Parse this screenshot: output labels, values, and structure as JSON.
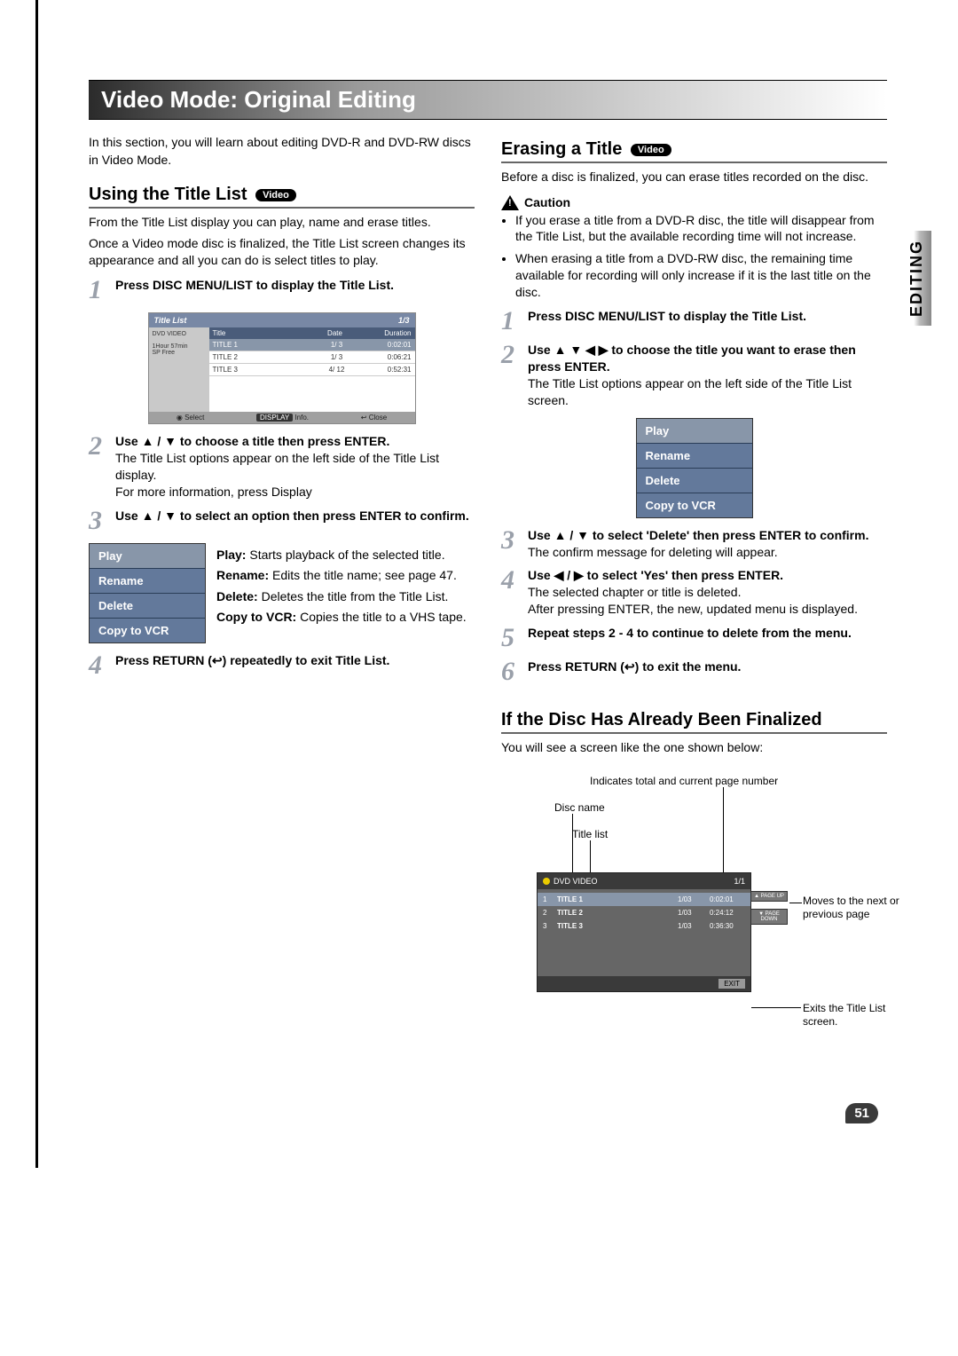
{
  "side_tab": "EDITING",
  "header": "Video Mode: Original Editing",
  "page_number": "51",
  "left": {
    "intro": "In this section, you will learn about editing DVD-R and DVD-RW discs in Video Mode.",
    "h2": "Using the Title List",
    "badge": "Video",
    "p1": "From the Title List display you can play, name and erase titles.",
    "p2": "Once a Video mode disc is finalized, the Title List screen changes its appearance and all you can do is select titles to play.",
    "step1": "Press DISC MENU/LIST to display the Title List.",
    "titlelist": {
      "header": "Title List",
      "page": "1/3",
      "cols": {
        "title": "Title",
        "date": "Date",
        "duration": "Duration"
      },
      "side": {
        "disc": "DVD VIDEO",
        "rec": "1Hour 57min",
        "mode": "SP Free"
      },
      "rows": [
        {
          "title": "TITLE 1",
          "date": "1/ 3",
          "dur": "0:02:01"
        },
        {
          "title": "TITLE 2",
          "date": "1/ 3",
          "dur": "0:06:21"
        },
        {
          "title": "TITLE 3",
          "date": "4/ 12",
          "dur": "0:52:31"
        }
      ],
      "foot": {
        "select": "Select",
        "display": "DISPLAY",
        "info": "Info.",
        "close": "Close"
      }
    },
    "step2": "Use ▲ / ▼ to choose a title then press ENTER.",
    "step2b": "The Title List options appear on the left side of the Title List display.",
    "step2c": "For more information, press Display",
    "step3": "Use ▲ / ▼ to select an option then press ENTER to confirm.",
    "options": [
      "Play",
      "Rename",
      "Delete",
      "Copy to VCR"
    ],
    "desc_play_label": "Play:",
    "desc_play": " Starts playback of the selected title.",
    "desc_rename_label": "Rename:",
    "desc_rename": " Edits the title name; see page 47.",
    "desc_delete_label": "Delete:",
    "desc_delete": " Deletes the title from the Title List.",
    "desc_copy_label": "Copy to VCR:",
    "desc_copy": " Copies the title to a VHS tape.",
    "step4": "Press RETURN (↩) repeatedly to exit Title List."
  },
  "right": {
    "h2": "Erasing a Title",
    "badge": "Video",
    "p1": "Before a disc is finalized, you can erase titles recorded on the disc.",
    "caution": "Caution",
    "c1": "If you erase a title from a DVD-R disc, the title will disappear from the Title List, but the available recording time will not increase.",
    "c2": "When erasing a title from a DVD-RW disc, the remaining time available for recording will only increase if it is the last title on the disc.",
    "step1": "Press DISC MENU/LIST to display the Title List.",
    "step2": "Use ▲ ▼ ◀ ▶ to choose the title you want to erase then press ENTER.",
    "step2b": "The Title List options appear on the left side of the Title List screen.",
    "options": [
      "Play",
      "Rename",
      "Delete",
      "Copy to VCR"
    ],
    "step3": "Use ▲ / ▼ to select 'Delete' then press ENTER to confirm.",
    "step3b": "The confirm message for deleting will appear.",
    "step4": "Use ◀ / ▶ to select 'Yes' then press ENTER.",
    "step4b": "The selected chapter or title is deleted.",
    "step4c": "After pressing ENTER, the new, updated menu is displayed.",
    "step5": "Repeat steps 2 - 4 to continue to delete from the menu.",
    "step6": "Press RETURN (↩) to exit the menu.",
    "h2b": "If the Disc Has Already Been Finalized",
    "p_final": "You will see a screen like the one shown below:",
    "callouts": {
      "total": "Indicates total and current page number",
      "disc_name": "Disc name",
      "title_list": "Title list",
      "move": "Moves to the next or previous page",
      "exit": "Exits the Title List screen."
    },
    "dvd": {
      "label": "DVD VIDEO",
      "page": "1/1",
      "rows": [
        {
          "n": "1",
          "title": "TITLE 1",
          "date": "1/03",
          "dur": "0:02:01"
        },
        {
          "n": "2",
          "title": "TITLE 2",
          "date": "1/03",
          "dur": "0:24:12"
        },
        {
          "n": "3",
          "title": "TITLE 3",
          "date": "1/03",
          "dur": "0:36:30"
        }
      ],
      "page_up": "▲ PAGE UP",
      "page_down": "▼ PAGE DOWN",
      "exit": "EXIT"
    }
  }
}
